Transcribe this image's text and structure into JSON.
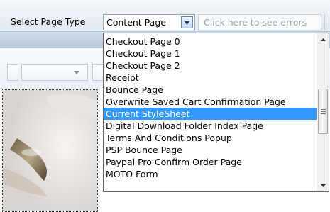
{
  "toolbar": {
    "select_label": "Select Page Type",
    "selected_value": "Content Page",
    "errors_link": "Click here to see errors"
  },
  "dropdown": {
    "items": [
      {
        "label": "Checkout Page 0",
        "selected": false
      },
      {
        "label": "Checkout Page 1",
        "selected": false
      },
      {
        "label": "Checkout Page 2",
        "selected": false
      },
      {
        "label": "Receipt",
        "selected": false
      },
      {
        "label": "Bounce Page",
        "selected": false
      },
      {
        "label": "Overwrite Saved Cart Confirmation Page",
        "selected": false
      },
      {
        "label": "Current StyleSheet",
        "selected": true
      },
      {
        "label": "Digital Download Folder Index Page",
        "selected": false
      },
      {
        "label": "Terms And Conditions Popup",
        "selected": false
      },
      {
        "label": "PSP Bounce Page",
        "selected": false
      },
      {
        "label": "Paypal Pro Confirm Order Page",
        "selected": false
      },
      {
        "label": "MOTO Form",
        "selected": false
      }
    ]
  },
  "colors": {
    "selection": "#3399ff",
    "toolbar_bg": "#e3e9f1",
    "border_blue": "#8ea6c1"
  },
  "icons": {
    "select_arrow": "chevron-down-icon",
    "scroll_up": "arrow-up-icon",
    "scroll_down": "arrow-down-icon"
  }
}
